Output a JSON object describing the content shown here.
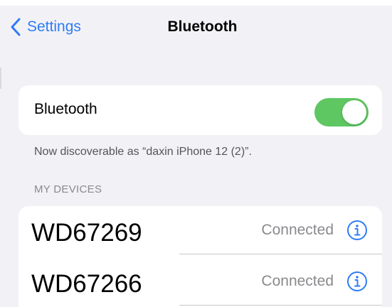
{
  "nav": {
    "back_label": "Settings",
    "title": "Bluetooth"
  },
  "bluetooth": {
    "label": "Bluetooth",
    "enabled": true,
    "toggle_color": "#5fc762"
  },
  "discoverable_note": "Now discoverable as “daxin iPhone 12 (2)”.",
  "my_devices": {
    "header": "MY DEVICES",
    "items": [
      {
        "name": "WD67269",
        "status": "Connected",
        "info_icon": "info-circle-icon"
      },
      {
        "name": "WD67266",
        "status": "Connected",
        "info_icon": "info-circle-icon"
      }
    ]
  },
  "colors": {
    "accent": "#2f7cf6",
    "background": "#f2f2f6",
    "secondary_text": "#8a8a8e"
  }
}
